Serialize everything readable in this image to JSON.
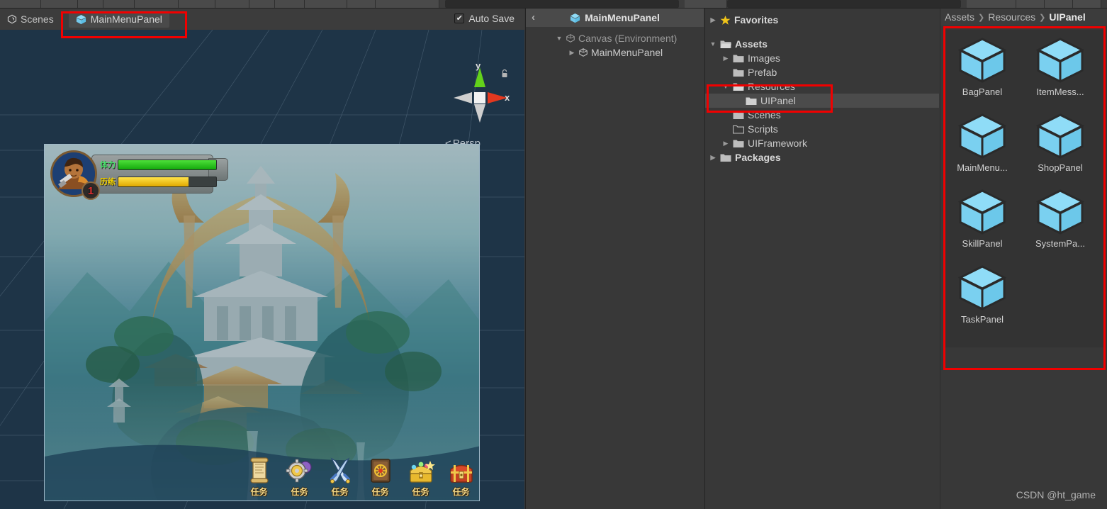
{
  "colors": {
    "annotation": "#f10000",
    "panel_bg": "#383838",
    "tab_bg": "#4a4a4a",
    "scene_bg": "#1e3447",
    "prefab_cube": "#7fd4f5",
    "axis_y": "#5ec918",
    "axis_x": "#e33b26",
    "hp_bar": "#28c21a",
    "xp_bar": "#f2c400",
    "selection_row": "#4b4b4b",
    "favorites_star": "#f0c419"
  },
  "toolbar": {
    "note": "cut-off toolbar strip along top edge"
  },
  "scene_panel": {
    "tab_label": "Scenes",
    "tab_icon": "unity-logo-icon",
    "prefab_tab": {
      "label": "MainMenuPanel",
      "icon": "prefab-cube-icon",
      "annotated": true
    },
    "auto_save": {
      "label": "Auto Save",
      "checked": true,
      "check_glyph": "✔"
    },
    "gizmo": {
      "axis_y_label": "y",
      "axis_x_label": "x",
      "lock_icon": "lock-icon"
    },
    "projection": {
      "arrow": "<",
      "label": "Persp"
    }
  },
  "game_hud": {
    "level": "1",
    "bars": [
      {
        "label": "体力",
        "label_color": "#49e06b",
        "fill_color": "#28c21a",
        "percent": 100
      },
      {
        "label": "历练",
        "label_color": "#f2d200",
        "fill_color": "#f2c400",
        "percent": 72
      }
    ],
    "action_buttons": [
      {
        "label": "任务",
        "icon": "scroll-icon"
      },
      {
        "label": "任务",
        "icon": "gears-coins-icon"
      },
      {
        "label": "任务",
        "icon": "crossed-swords-icon"
      },
      {
        "label": "任务",
        "icon": "book-icon"
      },
      {
        "label": "任务",
        "icon": "treasure-chest-gold-icon"
      },
      {
        "label": "任务",
        "icon": "chest-red-icon"
      }
    ]
  },
  "hierarchy": {
    "back_chevron": "‹",
    "title": "MainMenuPanel",
    "title_icon": "prefab-cube-icon",
    "rows": [
      {
        "indent": 1,
        "triangle": "▼",
        "icon": "gameobject-cube-icon",
        "label": "Canvas (Environment)",
        "dim": true
      },
      {
        "indent": 2,
        "triangle": "▶",
        "icon": "gameobject-cube-icon",
        "label": "MainMenuPanel",
        "dim": false
      }
    ]
  },
  "project": {
    "tree": [
      {
        "indent": 0,
        "triangle": "▶",
        "icon": "star-icon",
        "label": "Favorites",
        "bold": true,
        "selected": false
      },
      {
        "indent": 0,
        "triangle": "",
        "icon": "",
        "label": "",
        "bold": false,
        "selected": false,
        "spacer": true
      },
      {
        "indent": 0,
        "triangle": "▼",
        "icon": "folder-open-icon",
        "label": "Assets",
        "bold": true,
        "selected": false
      },
      {
        "indent": 1,
        "triangle": "▶",
        "icon": "folder-icon",
        "label": "Images",
        "bold": false,
        "selected": false
      },
      {
        "indent": 1,
        "triangle": "",
        "icon": "folder-icon",
        "label": "Prefab",
        "bold": false,
        "selected": false
      },
      {
        "indent": 1,
        "triangle": "▼",
        "icon": "folder-open-icon",
        "label": "Resources",
        "bold": false,
        "selected": false
      },
      {
        "indent": 2,
        "triangle": "",
        "icon": "folder-icon",
        "label": "UIPanel",
        "bold": false,
        "selected": true
      },
      {
        "indent": 1,
        "triangle": "",
        "icon": "folder-icon",
        "label": "Scenes",
        "bold": false,
        "selected": false
      },
      {
        "indent": 1,
        "triangle": "",
        "icon": "folder-empty-icon",
        "label": "Scripts",
        "bold": false,
        "selected": false
      },
      {
        "indent": 1,
        "triangle": "▶",
        "icon": "folder-icon",
        "label": "UIFramework",
        "bold": false,
        "selected": false
      },
      {
        "indent": 0,
        "triangle": "▶",
        "icon": "folder-icon",
        "label": "Packages",
        "bold": true,
        "selected": false
      }
    ],
    "breadcrumb": {
      "parts": [
        "Assets",
        "Resources"
      ],
      "current": "UIPanel",
      "separator": "❯"
    },
    "assets": [
      {
        "label": "BagPanel",
        "icon": "prefab-cube-icon"
      },
      {
        "label": "ItemMess...",
        "icon": "prefab-cube-icon"
      },
      {
        "label": "MainMenu...",
        "icon": "prefab-cube-icon"
      },
      {
        "label": "ShopPanel",
        "icon": "prefab-cube-icon"
      },
      {
        "label": "SkillPanel",
        "icon": "prefab-cube-icon"
      },
      {
        "label": "SystemPa...",
        "icon": "prefab-cube-icon"
      },
      {
        "label": "TaskPanel",
        "icon": "prefab-cube-icon"
      }
    ]
  },
  "watermark": "CSDN @ht_game"
}
